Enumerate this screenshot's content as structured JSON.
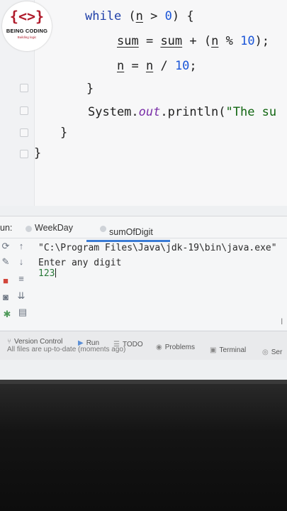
{
  "logo": {
    "glyph": "{<>}",
    "title": "BEING CODING",
    "subtitle": "Building logic"
  },
  "editor": {
    "lines": [
      {
        "kw": "while",
        "rest1": " (",
        "var1": "n",
        "rest2": " > ",
        "num1": "0",
        "rest3": ") {"
      },
      {
        "var1": "sum",
        "rest1": " = ",
        "var2": "sum",
        "rest2": " + (",
        "var3": "n",
        "rest3": " % ",
        "num1": "10",
        "rest4": ");"
      },
      {
        "var1": "n",
        "rest1": " = ",
        "var2": "n",
        "rest2": " / ",
        "num1": "10",
        "rest3": ";"
      },
      {
        "text": "}"
      },
      {
        "pre": "System.",
        "field": "out",
        "mid": ".println(",
        "str": "\"The su"
      },
      {
        "text": "}"
      },
      {
        "text": "}"
      }
    ]
  },
  "run_panel": {
    "label": "un:",
    "tabs": [
      {
        "label": "WeekDay"
      },
      {
        "label": "sumOfDigit"
      }
    ],
    "console": [
      "\"C:\\Program Files\\Java\\jdk-19\\bin\\java.exe\"",
      "Enter any digit",
      "123"
    ]
  },
  "bottom_bar": {
    "items": [
      {
        "label": "Version Control",
        "icon": "branch-icon"
      },
      {
        "label": "Run",
        "icon": "play-icon"
      },
      {
        "label": "TODO",
        "icon": "list-icon"
      },
      {
        "label": "Problems",
        "icon": "warning-icon"
      },
      {
        "label": "Terminal",
        "icon": "terminal-icon"
      },
      {
        "label": "Ser",
        "icon": "services-icon"
      }
    ],
    "status": "All files are up-to-date (moments ago)"
  },
  "colors": {
    "keyword": "#1f3fa8",
    "number": "#1a55d8",
    "field": "#7a2fa8",
    "accent": "#3a7bd5",
    "logo_red": "#b01b2b"
  }
}
